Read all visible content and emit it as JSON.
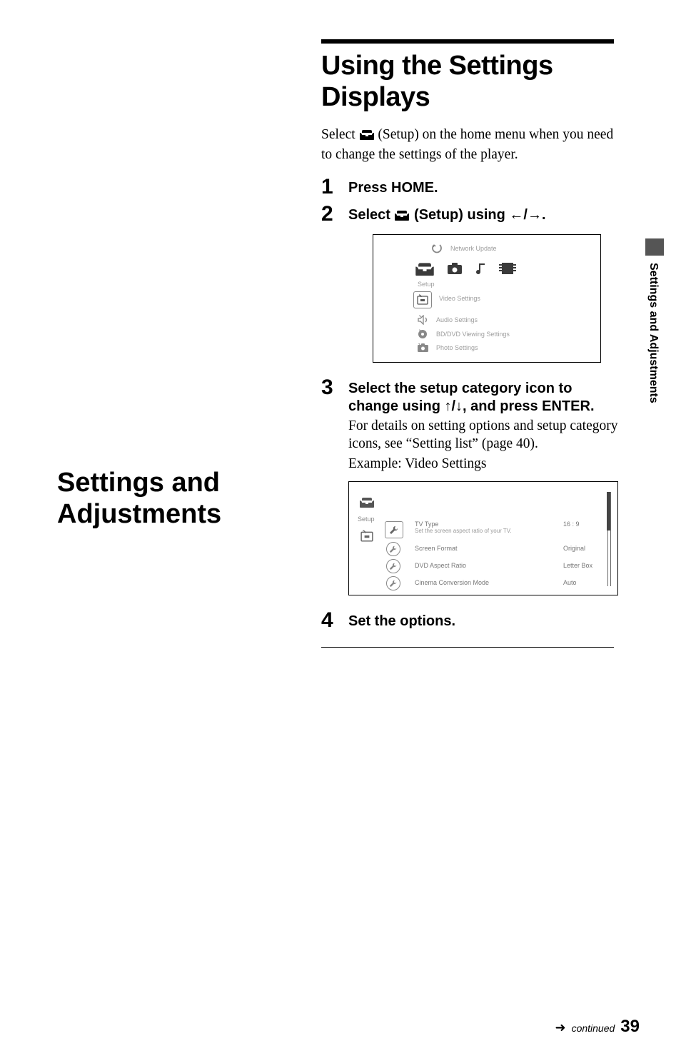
{
  "side_tab": "Settings and Adjustments",
  "left": {
    "title_line1": "Settings and",
    "title_line2": "Adjustments"
  },
  "right": {
    "title_line1": "Using the Settings",
    "title_line2": "Displays",
    "intro_pre": "Select ",
    "intro_post": " (Setup) on the home menu when you need to change the settings of the player.",
    "steps": {
      "s1": {
        "num": "1",
        "heading": "Press HOME."
      },
      "s2": {
        "num": "2",
        "heading_pre": "Select ",
        "heading_mid": " (Setup) using ",
        "heading_post": "."
      },
      "s3": {
        "num": "3",
        "heading_line1": "Select the setup category icon to",
        "heading_line2_pre": "change using ",
        "heading_line2_post": ", and press ENTER.",
        "body1": "For details on setting options and setup category icons, see “Setting list” (page 40).",
        "body2": "Example: Video Settings"
      },
      "s4": {
        "num": "4",
        "heading": "Set the options."
      }
    }
  },
  "screenshot1": {
    "network_update": "Network Update",
    "setup_label": "Setup",
    "video_settings": "Video Settings",
    "audio_settings": "Audio Settings",
    "bd_dvd": "BD/DVD Viewing Settings",
    "photo_settings": "Photo Settings"
  },
  "screenshot2": {
    "setup_label": "Setup",
    "items": [
      {
        "title": "TV Type",
        "sub": "Set the screen aspect ratio of your TV.",
        "value": "16 : 9"
      },
      {
        "title": "Screen Format",
        "sub": "",
        "value": "Original"
      },
      {
        "title": "DVD Aspect Ratio",
        "sub": "",
        "value": "Letter Box"
      },
      {
        "title": "Cinema Conversion Mode",
        "sub": "",
        "value": "Auto"
      }
    ]
  },
  "footer": {
    "continued": "continued",
    "page": "39"
  },
  "glyphs": {
    "left_arrow": "←",
    "right_arrow": "→",
    "up_arrow": "↑",
    "down_arrow": "↓",
    "slash": "/",
    "right_arrow_footer": "➜"
  }
}
